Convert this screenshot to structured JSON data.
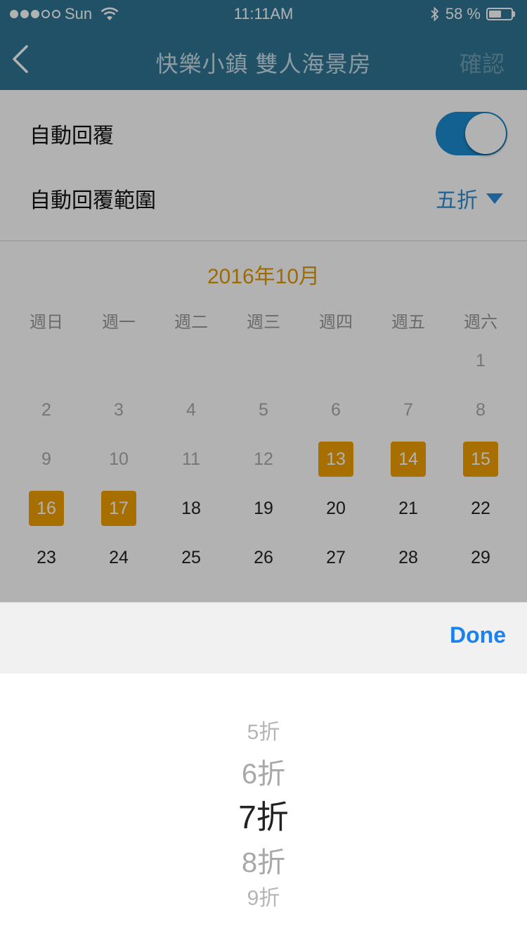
{
  "status_bar": {
    "carrier": "Sun",
    "time": "11:11AM",
    "battery": "58 %",
    "battery_level": 0.58
  },
  "nav": {
    "title": "快樂小鎮 雙人海景房",
    "confirm": "確認"
  },
  "settings": {
    "auto_reply_label": "自動回覆",
    "auto_reply_on": true,
    "range_label": "自動回覆範圍",
    "range_value": "五折"
  },
  "calendar": {
    "month": "2016年10月",
    "weekdays": [
      "週日",
      "週一",
      "週二",
      "週三",
      "週四",
      "週五",
      "週六"
    ],
    "rows": [
      [
        null,
        null,
        null,
        null,
        null,
        null,
        {
          "d": "1",
          "s": "past"
        }
      ],
      [
        {
          "d": "2",
          "s": "past"
        },
        {
          "d": "3",
          "s": "past"
        },
        {
          "d": "4",
          "s": "past"
        },
        {
          "d": "5",
          "s": "past"
        },
        {
          "d": "6",
          "s": "past"
        },
        {
          "d": "7",
          "s": "past"
        },
        {
          "d": "8",
          "s": "past"
        }
      ],
      [
        {
          "d": "9",
          "s": "past"
        },
        {
          "d": "10",
          "s": "past"
        },
        {
          "d": "11",
          "s": "past"
        },
        {
          "d": "12",
          "s": "past"
        },
        {
          "d": "13",
          "s": "sel"
        },
        {
          "d": "14",
          "s": "sel"
        },
        {
          "d": "15",
          "s": "sel"
        }
      ],
      [
        {
          "d": "16",
          "s": "sel"
        },
        {
          "d": "17",
          "s": "sel"
        },
        {
          "d": "18",
          "s": "normal"
        },
        {
          "d": "19",
          "s": "normal"
        },
        {
          "d": "20",
          "s": "normal"
        },
        {
          "d": "21",
          "s": "normal"
        },
        {
          "d": "22",
          "s": "normal"
        }
      ],
      [
        {
          "d": "23",
          "s": "normal"
        },
        {
          "d": "24",
          "s": "normal"
        },
        {
          "d": "25",
          "s": "normal"
        },
        {
          "d": "26",
          "s": "normal"
        },
        {
          "d": "27",
          "s": "normal"
        },
        {
          "d": "28",
          "s": "normal"
        },
        {
          "d": "29",
          "s": "normal"
        }
      ]
    ]
  },
  "picker": {
    "done": "Done",
    "options": [
      "5折",
      "6折",
      "7折",
      "8折",
      "9折"
    ],
    "selected_index": 2
  }
}
